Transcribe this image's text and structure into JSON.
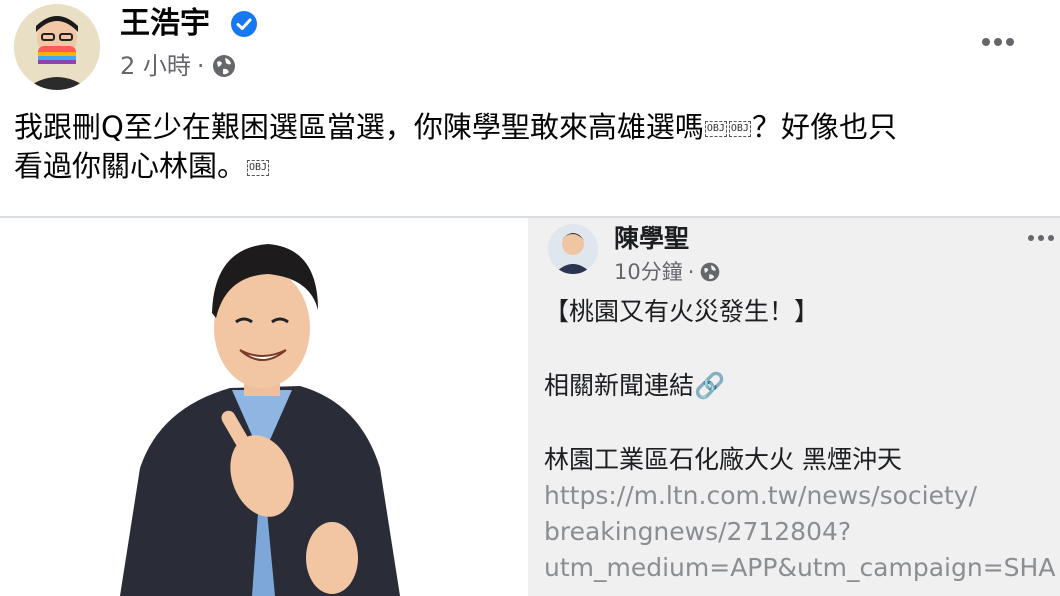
{
  "post": {
    "author_name": "王浩宇",
    "verified": true,
    "time": "2 小時",
    "separator": "·",
    "privacy_icon": "globe-icon",
    "more_icon": "more-horizontal-icon",
    "text_line1_before": "我跟刪Q至少在艱困選區當選，你陳學聖敢來高雄選嗎",
    "text_line1_after": "？好像也只",
    "text_line2": "看過你關心林園。",
    "obj_placeholder": "OBJ"
  },
  "inner_post": {
    "author_name": "陳學聖",
    "time": "10分鐘",
    "separator": "·",
    "privacy_icon": "globe-icon",
    "more_icon": "more-horizontal-icon",
    "line1": "【桃園又有火災發生！】",
    "line2": "相關新聞連結🔗",
    "line3": "林園工業區石化廠大火 黑煙沖天",
    "link_line1": "https://m.ltn.com.tw/news/society/",
    "link_line2": "breakingnews/2712804?",
    "link_line3": "utm_medium=APP&utm_campaign=SHA"
  },
  "colors": {
    "verified_blue": "#1877f2",
    "meta_gray": "#65676b",
    "divider": "#dadde1"
  }
}
